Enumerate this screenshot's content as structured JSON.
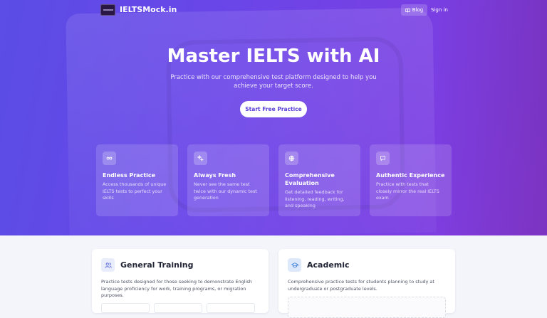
{
  "nav": {
    "brand": "IELTSMock.in",
    "blog_label": "Blog",
    "signin_label": "Sign in"
  },
  "hero": {
    "title": "Master IELTS with AI",
    "subtitle": "Practice with our comprehensive test platform designed to help you achieve your target score.",
    "cta_label": "Start Free Practice"
  },
  "features": [
    {
      "icon": "infinity-icon",
      "title": "Endless Practice",
      "desc": "Access thousands of unique IELTS tests to perfect your skills"
    },
    {
      "icon": "sparkle-icon",
      "title": "Always Fresh",
      "desc": "Never see the same test twice with our dynamic test generation"
    },
    {
      "icon": "globe-icon",
      "title": "Comprehensive Evaluation",
      "desc": "Get detailed feedback for listening, reading, writing, and speaking"
    },
    {
      "icon": "chat-icon",
      "title": "Authentic Experience",
      "desc": "Practice with tests that closely mirror the real IELTS exam"
    }
  ],
  "modules": [
    {
      "icon": "users-icon",
      "title": "General Training",
      "desc": "Practice tests designed for those seeking to demonstrate English language proficiency for work, training programs, or migration purposes."
    },
    {
      "icon": "graduation-cap-icon",
      "title": "Academic",
      "desc": "Comprehensive practice tests for students planning to study at undergraduate or postgraduate levels."
    }
  ],
  "colors": {
    "hero_start": "#5b4de6",
    "hero_end": "#8a3ad8",
    "cta_text": "#5a3fd6",
    "page_bg": "#f4f5fb"
  }
}
